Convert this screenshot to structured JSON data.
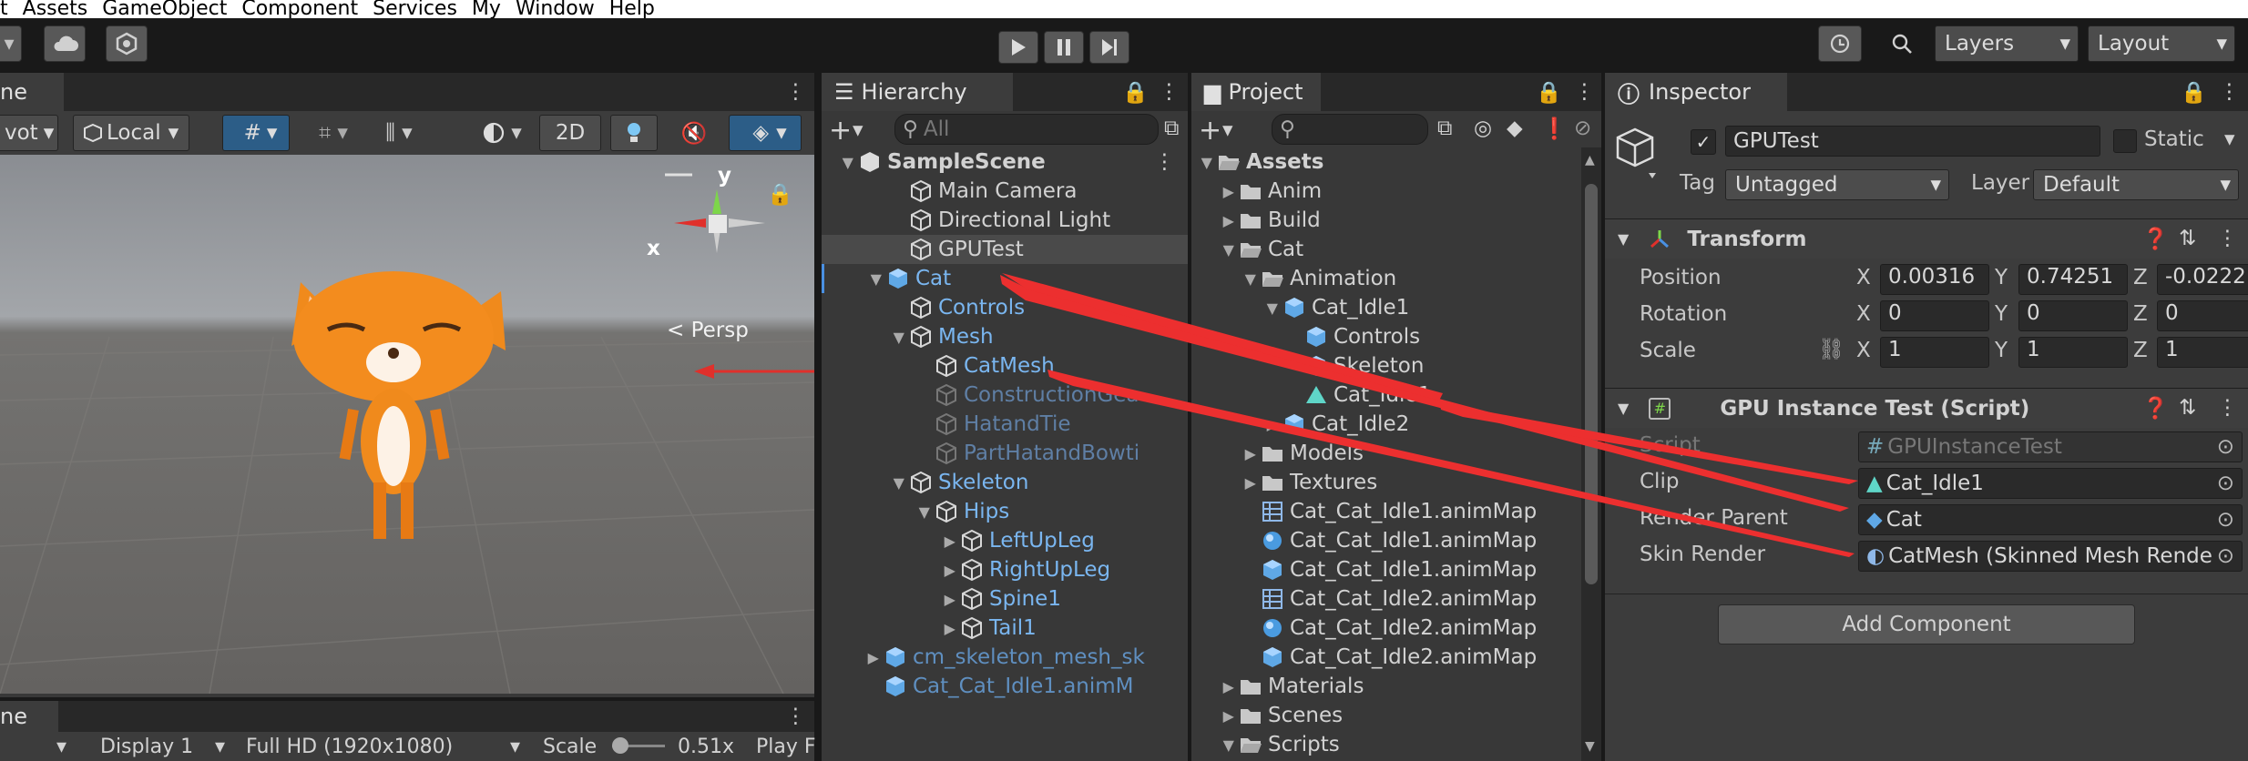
{
  "menu": [
    "t",
    "Assets",
    "GameObject",
    "Component",
    "Services",
    "My",
    "Window",
    "Help"
  ],
  "toolbar": {
    "layers_label": "Layers",
    "layout_label": "Layout"
  },
  "scene": {
    "tab": "ne",
    "pivot": "vot",
    "local": "Local",
    "mode2d": "2D",
    "persp": "< Persp",
    "axis_y": "y",
    "axis_x": "x"
  },
  "game": {
    "tab": "ne",
    "display": "Display 1",
    "resolution": "Full HD (1920x1080)",
    "scale_label": "Scale",
    "scale_value": "0.51x",
    "play": "Play F"
  },
  "hierarchy": {
    "title": "Hierarchy",
    "search_placeholder": "All",
    "rows": [
      {
        "label": "SampleScene",
        "indent": 0,
        "arrow": "▼",
        "style": "scene"
      },
      {
        "label": "Main Camera",
        "indent": 2,
        "arrow": "",
        "style": "normal"
      },
      {
        "label": "Directional Light",
        "indent": 2,
        "arrow": "",
        "style": "normal"
      },
      {
        "label": "GPUTest",
        "indent": 2,
        "arrow": "",
        "style": "selected"
      },
      {
        "label": "Cat",
        "indent": 1,
        "arrow": "▼",
        "style": "prefab"
      },
      {
        "label": "Controls",
        "indent": 2,
        "arrow": "",
        "style": "prefab"
      },
      {
        "label": "Mesh",
        "indent": 2,
        "arrow": "▼",
        "style": "prefab"
      },
      {
        "label": "CatMesh",
        "indent": 3,
        "arrow": "",
        "style": "prefab"
      },
      {
        "label": "ConstructionGea",
        "indent": 3,
        "arrow": "",
        "style": "dim"
      },
      {
        "label": "HatandTie",
        "indent": 3,
        "arrow": "",
        "style": "dim"
      },
      {
        "label": "PartHatandBowti",
        "indent": 3,
        "arrow": "",
        "style": "dim"
      },
      {
        "label": "Skeleton",
        "indent": 2,
        "arrow": "▼",
        "style": "prefab"
      },
      {
        "label": "Hips",
        "indent": 3,
        "arrow": "▼",
        "style": "prefab"
      },
      {
        "label": "LeftUpLeg",
        "indent": 4,
        "arrow": "▶",
        "style": "prefab"
      },
      {
        "label": "RightUpLeg",
        "indent": 4,
        "arrow": "▶",
        "style": "prefab"
      },
      {
        "label": "Spine1",
        "indent": 4,
        "arrow": "▶",
        "style": "prefab"
      },
      {
        "label": "Tail1",
        "indent": 4,
        "arrow": "▶",
        "style": "prefab"
      },
      {
        "label": "cm_skeleton_mesh_sk",
        "indent": 1,
        "arrow": "▶",
        "style": "dimblue"
      },
      {
        "label": "Cat_Cat_Idle1.animM",
        "indent": 1,
        "arrow": "",
        "style": "dimblue"
      }
    ]
  },
  "project": {
    "title": "Project",
    "search_placeholder": "",
    "badge": "",
    "rows": [
      {
        "label": "Assets",
        "indent": 0,
        "arrow": "▼",
        "icon": "folder-open"
      },
      {
        "label": "Anim",
        "indent": 1,
        "arrow": "▶",
        "icon": "folder"
      },
      {
        "label": "Build",
        "indent": 1,
        "arrow": "▶",
        "icon": "folder"
      },
      {
        "label": "Cat",
        "indent": 1,
        "arrow": "▼",
        "icon": "folder-open"
      },
      {
        "label": "Animation",
        "indent": 2,
        "arrow": "▼",
        "icon": "folder-open"
      },
      {
        "label": "Cat_Idle1",
        "indent": 3,
        "arrow": "▼",
        "icon": "prefab"
      },
      {
        "label": "Controls",
        "indent": 4,
        "arrow": "",
        "icon": "prefab"
      },
      {
        "label": "Skeleton",
        "indent": 4,
        "arrow": "",
        "icon": "prefab"
      },
      {
        "label": "Cat_Idle1",
        "indent": 4,
        "arrow": "",
        "icon": "clip"
      },
      {
        "label": "Cat_Idle2",
        "indent": 3,
        "arrow": "▶",
        "icon": "prefab"
      },
      {
        "label": "Models",
        "indent": 2,
        "arrow": "▶",
        "icon": "folder"
      },
      {
        "label": "Textures",
        "indent": 2,
        "arrow": "▶",
        "icon": "folder"
      },
      {
        "label": "Cat_Cat_Idle1.animMap",
        "indent": 2,
        "arrow": "",
        "icon": "texture"
      },
      {
        "label": "Cat_Cat_Idle1.animMap",
        "indent": 2,
        "arrow": "",
        "icon": "material"
      },
      {
        "label": "Cat_Cat_Idle1.animMap",
        "indent": 2,
        "arrow": "",
        "icon": "prefab"
      },
      {
        "label": "Cat_Cat_Idle2.animMap",
        "indent": 2,
        "arrow": "",
        "icon": "texture"
      },
      {
        "label": "Cat_Cat_Idle2.animMap",
        "indent": 2,
        "arrow": "",
        "icon": "material"
      },
      {
        "label": "Cat_Cat_Idle2.animMap",
        "indent": 2,
        "arrow": "",
        "icon": "prefab"
      },
      {
        "label": "Materials",
        "indent": 1,
        "arrow": "▶",
        "icon": "folder"
      },
      {
        "label": "Scenes",
        "indent": 1,
        "arrow": "▶",
        "icon": "folder"
      },
      {
        "label": "Scripts",
        "indent": 1,
        "arrow": "▼",
        "icon": "folder-open"
      }
    ]
  },
  "inspector": {
    "title": "Inspector",
    "object_name": "GPUTest",
    "static_label": "Static",
    "tag_label": "Tag",
    "tag_value": "Untagged",
    "layer_label": "Layer",
    "layer_value": "Default",
    "transform": {
      "title": "Transform",
      "rows": [
        {
          "label": "Position",
          "x": "0.00316",
          "y": "0.74251",
          "z": "-0.0222"
        },
        {
          "label": "Rotation",
          "x": "0",
          "y": "0",
          "z": "0"
        },
        {
          "label": "Scale",
          "x": "1",
          "y": "1",
          "z": "1"
        }
      ]
    },
    "script_comp": {
      "title": "GPU Instance Test (Script)",
      "fields": [
        {
          "label": "Script",
          "value": "GPUInstanceTest",
          "icon": "script",
          "dim": true
        },
        {
          "label": "Clip",
          "value": "Cat_Idle1",
          "icon": "clip",
          "dim": false
        },
        {
          "label": "Render Parent",
          "value": "Cat",
          "icon": "prefab",
          "dim": false
        },
        {
          "label": "Skin Render",
          "value": "CatMesh (Skinned Mesh Rende",
          "icon": "skinned",
          "dim": false
        }
      ]
    },
    "add_component": "Add Component",
    "axis": {
      "x": "X",
      "y": "Y",
      "z": "Z"
    }
  },
  "colors": {
    "accent": "#2c5d87",
    "arrow": "#e0302b",
    "prefab": "#7ab6f0"
  }
}
